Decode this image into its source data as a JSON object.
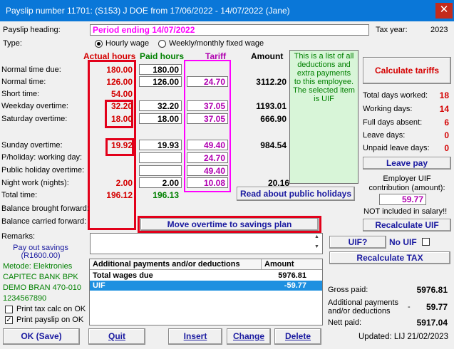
{
  "window": {
    "title": "Payslip number 11701: (S153) J DOE from 17/06/2022 - 14/07/2022 (Jane)"
  },
  "header": {
    "payslip_heading_label": "Payslip heading:",
    "payslip_heading_value": "Period ending 14/07/2022",
    "tax_year_label": "Tax year:",
    "tax_year_value": "2023",
    "type_label": "Type:",
    "type_options": [
      "Hourly wage",
      "Weekly/monthly fixed wage"
    ]
  },
  "columns": {
    "actual": "Actual hours",
    "paid": "Paid hours",
    "tariff": "Tariff",
    "amount": "Amount"
  },
  "rows": [
    {
      "label": "Normal time due:",
      "actual": "180.00",
      "paid": "180.00",
      "tariff": "",
      "amount": ""
    },
    {
      "label": "Normal time:",
      "actual": "126.00",
      "paid": "126.00",
      "tariff": "24.70",
      "amount": "3112.20"
    },
    {
      "label": "Short time:",
      "actual": "54.00",
      "paid": "",
      "tariff": "",
      "amount": ""
    },
    {
      "label": "Weekday overtime:",
      "actual": "32.20",
      "paid": "32.20",
      "tariff": "37.05",
      "amount": "1193.01"
    },
    {
      "label": "Saturday overtime:",
      "actual": "18.00",
      "paid": "18.00",
      "tariff": "37.05",
      "amount": "666.90"
    },
    {
      "label": "Sunday overtime:",
      "actual": "19.92",
      "paid": "19.93",
      "tariff": "49.40",
      "amount": "984.54"
    },
    {
      "label": "P/holiday: working day:",
      "actual": "",
      "paid": "",
      "tariff": "24.70",
      "amount": ""
    },
    {
      "label": "Public holiday overtime:",
      "actual": "",
      "paid": "",
      "tariff": "49.40",
      "amount": ""
    },
    {
      "label": "Night work (nights):",
      "actual": "2.00",
      "paid": "2.00",
      "tariff": "10.08",
      "amount": "20.16"
    },
    {
      "label": "Total time:",
      "actual": "196.12",
      "paid": "196.13",
      "tariff": "",
      "amount": ""
    },
    {
      "label": "Balance brought forward:",
      "actual": "",
      "paid": "",
      "tariff": "",
      "amount": ""
    },
    {
      "label": "Balance carried forward:",
      "actual": "",
      "paid": "",
      "tariff": "",
      "amount": ""
    }
  ],
  "info_panel": "This is a list of all deductions and extra payments to this employee. The selected item is UIF",
  "buttons": {
    "calculate_tariffs": "Calculate tariffs",
    "leave_pay": "Leave pay",
    "read_public_holidays": "Read about public holidays",
    "move_overtime": "Move overtime to savings plan",
    "recalculate_uif": "Recalculate UIF",
    "uif_q": "UIF?",
    "no_uif": "No UIF",
    "recalculate_tax": "Recalculate TAX",
    "ok_save": "OK (Save)",
    "quit": "Quit",
    "insert": "Insert",
    "change": "Change",
    "delete": "Delete"
  },
  "stats": [
    {
      "label": "Total days worked:",
      "value": "18"
    },
    {
      "label": "Working days:",
      "value": "14"
    },
    {
      "label": "Full days absent:",
      "value": "6"
    },
    {
      "label": "Leave days:",
      "value": "0"
    },
    {
      "label": "Unpaid leave days:",
      "value": "0"
    }
  ],
  "employer_uif": {
    "label": "Employer UIF contribution (amount):",
    "value": "59.77",
    "note": "NOT included in salary!!"
  },
  "remarks_label": "Remarks:",
  "left_panel": {
    "pay_out_savings": "Pay out savings",
    "pay_out_amount": "(R1600.00)",
    "metode_lines": [
      "Metode: Elektronies",
      "CAPITEC BANK BPK",
      "DEMO BRAN 470-010",
      "1234567890"
    ],
    "print_tax_calc": "Print tax calc on OK",
    "print_payslip": "Print payslip on OK"
  },
  "table": {
    "headers": [
      "Additional payments and/or deductions",
      "Amount"
    ],
    "rows": [
      {
        "name": "Total wages due",
        "amount": "5976.81",
        "selected": false
      },
      {
        "name": "UIF",
        "amount": "-59.77",
        "selected": true
      }
    ]
  },
  "summary": {
    "gross_label": "Gross paid:",
    "gross_value": "5976.81",
    "additional_label": "Additional payments and/or deductions",
    "additional_sign": "-",
    "additional_value": "59.77",
    "nett_label": "Nett paid:",
    "nett_value": "5917.04",
    "updated": "Updated: LIJ 21/02/2023"
  }
}
